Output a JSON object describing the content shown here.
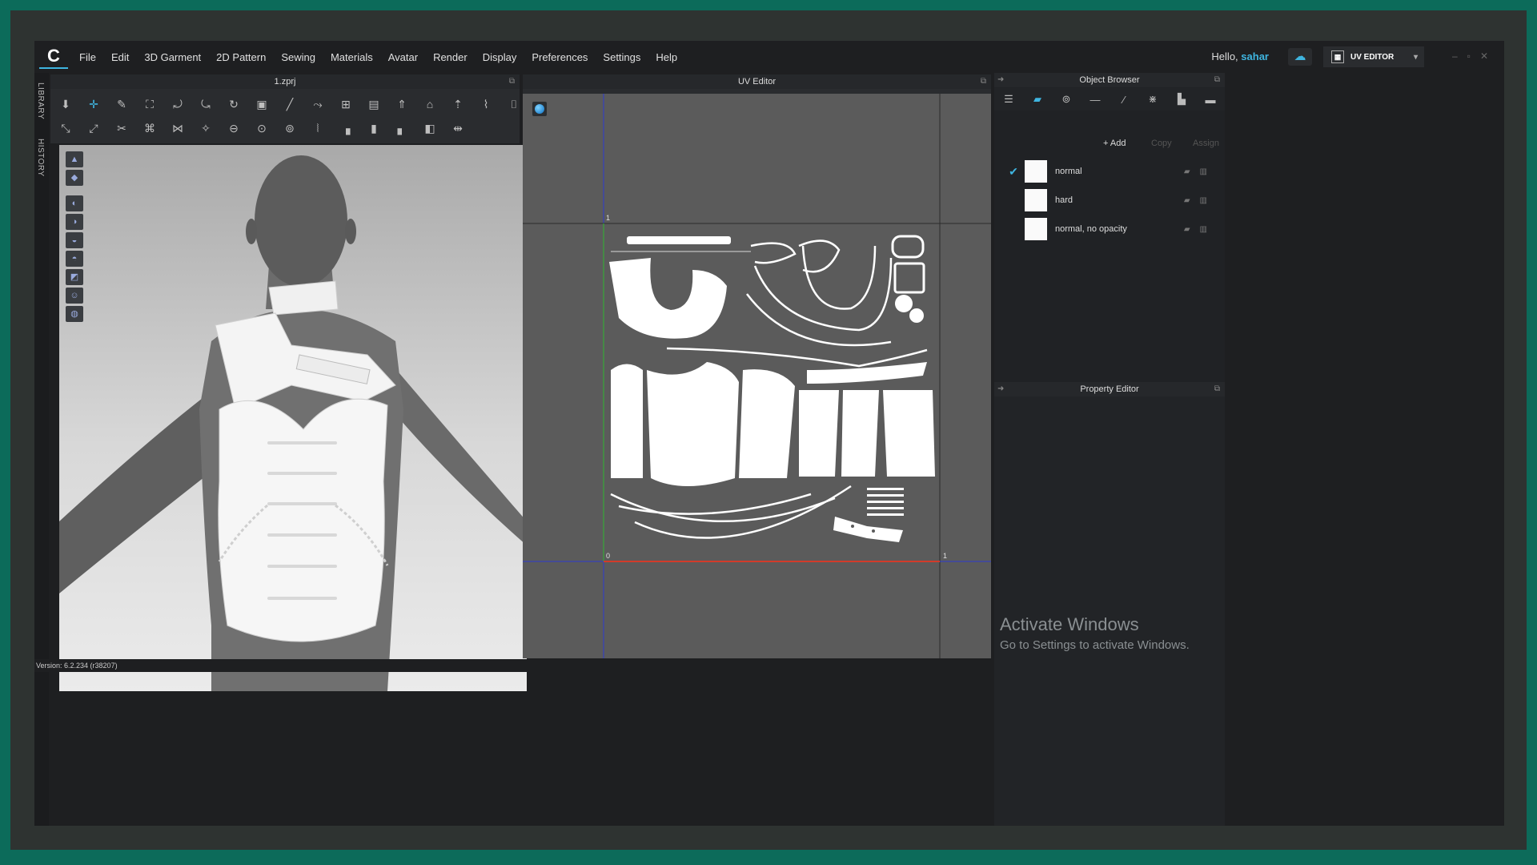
{
  "menubar": {
    "items": [
      "File",
      "Edit",
      "3D Garment",
      "2D Pattern",
      "Sewing",
      "Materials",
      "Avatar",
      "Render",
      "Display",
      "Preferences",
      "Settings",
      "Help"
    ],
    "hello_prefix": "Hello,",
    "user": "sahar",
    "mode_label": "UV EDITOR",
    "window_controls": [
      "–",
      "▫",
      "✕"
    ]
  },
  "sidetabs": {
    "library": "LIBRARY",
    "history": "HISTORY"
  },
  "viewport3d": {
    "title": "1.zprj"
  },
  "uv_editor": {
    "title": "UV Editor",
    "axis_labels": {
      "top_one": "1",
      "origin": "0",
      "right_one": "1"
    },
    "colors": {
      "u_axis": "#d23b2a",
      "v_axis": "#2fb72f",
      "grid_line": "#2d3bd0",
      "background": "#5b5b5b"
    }
  },
  "object_browser": {
    "title": "Object Browser",
    "actions": {
      "add": "+ Add",
      "copy": "Copy",
      "assign": "Assign"
    },
    "materials": [
      {
        "name": "normal",
        "selected": true
      },
      {
        "name": "hard",
        "selected": false
      },
      {
        "name": "normal, no opacity",
        "selected": false
      }
    ]
  },
  "property_editor": {
    "title": "Property Editor"
  },
  "status": {
    "version": "Version: 6.2.234 (r38207)"
  },
  "watermark": {
    "line1": "Activate Windows",
    "line2": "Go to Settings to activate Windows."
  },
  "accent_color": "#3fb5e0"
}
